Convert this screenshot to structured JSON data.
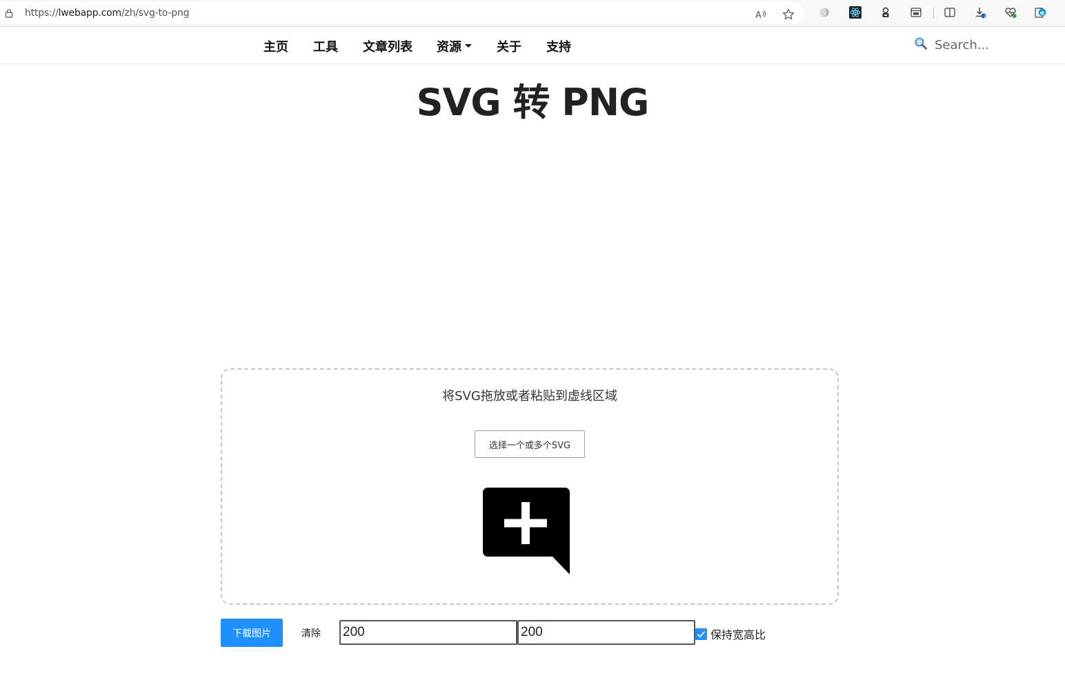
{
  "browser": {
    "url_prefix": "https://",
    "url_host": "lwebapp.com",
    "url_path": "/zh/svg-to-png",
    "toolbar_icons": [
      "read-aloud-icon",
      "favorite-star-icon",
      "extension-icon",
      "react-devtools-icon",
      "extension-2-icon",
      "extension-3-icon",
      "split-screen-icon",
      "downloads-icon",
      "browser-essentials-icon",
      "edge-icon"
    ]
  },
  "nav": {
    "items": [
      "主页",
      "工具",
      "文章列表",
      "资源",
      "关于",
      "支持"
    ],
    "search_placeholder": "Search..."
  },
  "page": {
    "title": "SVG 转 PNG"
  },
  "dropzone": {
    "hint": "将SVG拖放或者粘贴到虚线区域",
    "select_button": "选择一个或多个SVG"
  },
  "controls": {
    "download_label": "下载图片",
    "clear_label": "清除",
    "width_value": "200",
    "height_value": "200",
    "keep_ratio_label": "保持宽高比",
    "keep_ratio_checked": true
  },
  "colors": {
    "primary": "#1e90ff",
    "text": "#222222",
    "dashed_border": "#c4c4c4"
  }
}
